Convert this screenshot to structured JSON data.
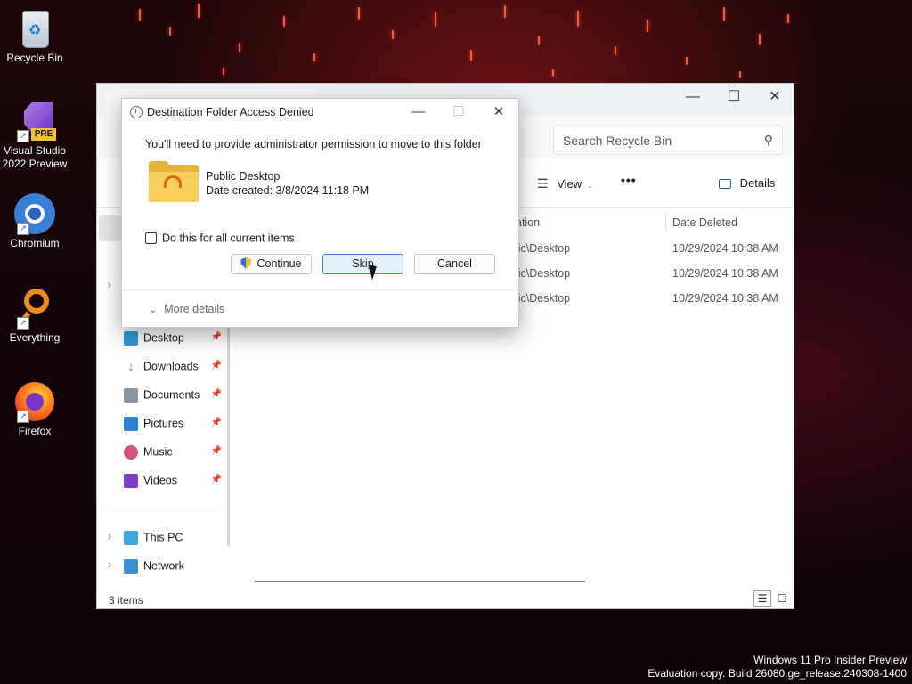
{
  "desktop": {
    "icons": [
      {
        "label": "Recycle Bin",
        "icon": "recycle-bin-icon"
      },
      {
        "label": "Visual Studio\n2022 Preview",
        "line1": "Visual Studio",
        "line2": "2022 Preview",
        "badge": "PRE",
        "icon": "visual-studio-icon"
      },
      {
        "label": "Chromium",
        "icon": "chromium-icon"
      },
      {
        "label": "Everything",
        "icon": "everything-search-icon"
      },
      {
        "label": "Firefox",
        "icon": "firefox-icon"
      }
    ],
    "watermark": {
      "line1": "Windows 11 Pro Insider Preview",
      "line2": "Evaluation copy. Build 26080.ge_release.240308-1400"
    }
  },
  "explorer": {
    "search_placeholder": "Search Recycle Bin",
    "toolbar": {
      "view_label": "View",
      "more_label": "•••",
      "details_label": "Details"
    },
    "nav": {
      "quick_access": [
        {
          "label": "Desktop",
          "icon": "desktop-folder-icon",
          "color": "#2f9ad8"
        },
        {
          "label": "Downloads",
          "icon": "download-icon",
          "color": "#2a9d66"
        },
        {
          "label": "Documents",
          "icon": "documents-icon",
          "color": "#7b8794"
        },
        {
          "label": "Pictures",
          "icon": "pictures-icon",
          "color": "#2f7fd8"
        },
        {
          "label": "Music",
          "icon": "music-icon",
          "color": "#d4547a"
        },
        {
          "label": "Videos",
          "icon": "videos-icon",
          "color": "#7a3fc9"
        }
      ],
      "this_pc": "This PC",
      "network": "Network"
    },
    "columns": {
      "location_partial": "ation",
      "date_deleted": "Date Deleted"
    },
    "rows": [
      {
        "location": "lic\\Desktop",
        "date_deleted": "10/29/2024 10:38 AM"
      },
      {
        "location": "lic\\Desktop",
        "date_deleted": "10/29/2024 10:38 AM"
      },
      {
        "location": "lic\\Desktop",
        "date_deleted": "10/29/2024 10:38 AM"
      }
    ],
    "status": {
      "item_count": "3 items"
    }
  },
  "dialog": {
    "title": "Destination Folder Access Denied",
    "message": "You'll need to provide administrator permission to move to this folder",
    "item": {
      "name": "Public Desktop",
      "date_created": "Date created: 3/8/2024 11:18 PM"
    },
    "checkbox_label": "Do this for all current items",
    "checkbox_checked": false,
    "buttons": {
      "continue": "Continue",
      "skip": "Skip",
      "cancel": "Cancel"
    },
    "more_details": "More details"
  }
}
